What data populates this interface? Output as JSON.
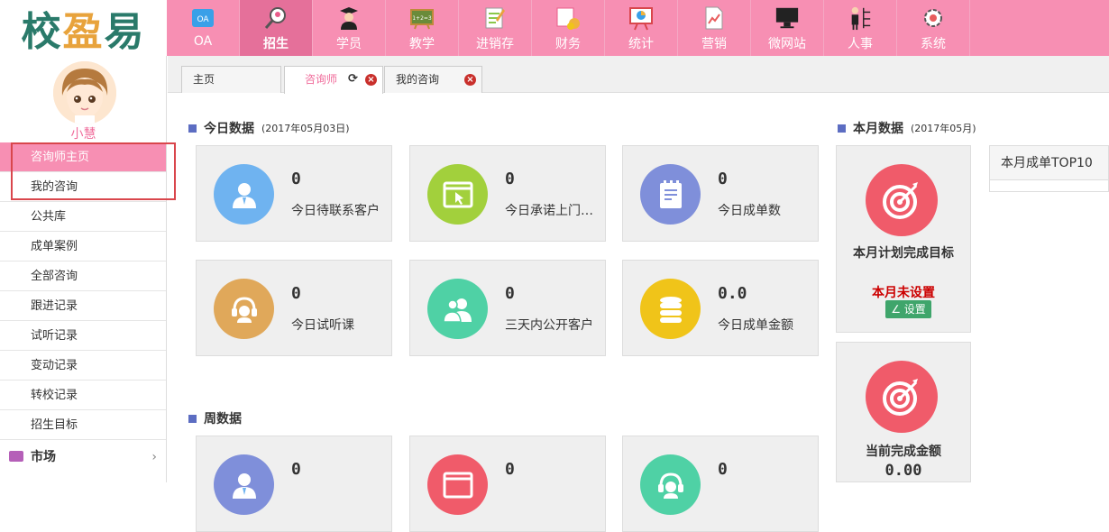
{
  "logo": {
    "text": "校盈易"
  },
  "nav": [
    {
      "label": "OA",
      "icon": "oa-icon"
    },
    {
      "label": "招生",
      "icon": "recruit-icon"
    },
    {
      "label": "学员",
      "icon": "student-icon"
    },
    {
      "label": "教学",
      "icon": "teaching-icon"
    },
    {
      "label": "进销存",
      "icon": "inventory-icon"
    },
    {
      "label": "财务",
      "icon": "finance-icon"
    },
    {
      "label": "统计",
      "icon": "statistics-icon"
    },
    {
      "label": "营销",
      "icon": "marketing-icon"
    },
    {
      "label": "微网站",
      "icon": "website-icon"
    },
    {
      "label": "人事",
      "icon": "hr-icon"
    },
    {
      "label": "系统",
      "icon": "system-icon"
    }
  ],
  "user": {
    "name": "小慧"
  },
  "sidebar": {
    "items": [
      "咨询师主页",
      "我的咨询",
      "公共库",
      "成单案例",
      "全部咨询",
      "跟进记录",
      "试听记录",
      "变动记录",
      "转校记录",
      "招生目标"
    ],
    "market": "市场",
    "market_arrow": "›"
  },
  "tabs": [
    {
      "label": "主页"
    },
    {
      "label": "咨询师",
      "refresh": "⟳",
      "close": "×"
    },
    {
      "label": "我的咨询",
      "close": "×"
    }
  ],
  "today": {
    "title": "今日数据",
    "date": "(2017年05月03日)",
    "cards": [
      {
        "value": "0",
        "label": "今日待联系客户",
        "color": "#6fb3f0",
        "icon": "user-icon"
      },
      {
        "value": "0",
        "label": "今日承诺上门…",
        "color": "#a2d03c",
        "icon": "browser-click-icon"
      },
      {
        "value": "0",
        "label": "今日成单数",
        "color": "#7f8fda",
        "icon": "notepad-icon"
      },
      {
        "value": "0",
        "label": "今日试听课",
        "color": "#e0a85a",
        "icon": "headset-icon"
      },
      {
        "value": "0",
        "label": "三天内公开客户",
        "color": "#4fd1a5",
        "icon": "users-icon"
      },
      {
        "value": "0.0",
        "label": "今日成单金额",
        "color": "#f0c419",
        "icon": "coins-icon"
      }
    ]
  },
  "week": {
    "title": "周数据",
    "cards": [
      {
        "value": "0",
        "color": "#7f8fda",
        "icon": "user-icon"
      },
      {
        "value": "0",
        "color": "#f05b6a",
        "icon": "browser-icon"
      },
      {
        "value": "0",
        "color": "#4fd1a5",
        "icon": "headset-icon"
      }
    ]
  },
  "month": {
    "title": "本月数据",
    "date": "(2017年05月)",
    "goal": {
      "label": "本月计划完成目标",
      "status": "本月未设置",
      "button": "∠ 设置"
    },
    "amount": {
      "label": "当前完成金额",
      "value": "0.00"
    },
    "top10": "本月成单TOP10"
  }
}
